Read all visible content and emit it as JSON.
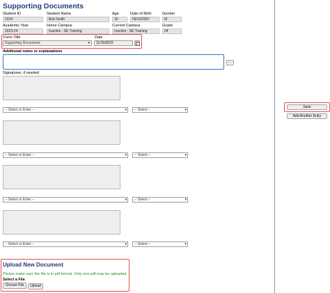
{
  "header": {
    "title": "Supporting Documents"
  },
  "student": {
    "row1_labels": [
      "Student ID",
      "Student Name",
      "Age",
      "Date of Birth",
      "Gender"
    ],
    "row1_values": [
      "1234",
      "Bob Smith",
      "16",
      "09/10/2007",
      "M"
    ],
    "row2_labels": [
      "Academic Year",
      "Home Campus",
      "Current Campus",
      "Grade"
    ],
    "row2_values": [
      "2023-24",
      "Inactive - SE Training",
      "Inactive - SE Training",
      "04"
    ]
  },
  "form": {
    "form_title_label": "Form Title",
    "form_title_value": "Supporting Documents",
    "date_label": "Date",
    "date_value": "11/15/2023"
  },
  "notes": {
    "label": "Additional notes or explanations",
    "expand_label": "..."
  },
  "signatures": {
    "label": "Signatures, if needed",
    "name_placeholder": "-- Select or Enter --",
    "role_placeholder": "-- Select --",
    "caret": "▾"
  },
  "upload": {
    "title": "Upload New Document",
    "note": "Please make sure the file is in pdf format. Only one pdf may be uploaded.",
    "select_label": "Select a File",
    "choose_label": "Choose File",
    "upload_label": "Upload"
  },
  "actions": {
    "save_label": "Save",
    "add_entry_label": "Add Another Entry"
  },
  "colors": {
    "title_blue": "#1f3f7a",
    "highlight_red": "#e0504e",
    "note_green": "#2c8a2c"
  }
}
